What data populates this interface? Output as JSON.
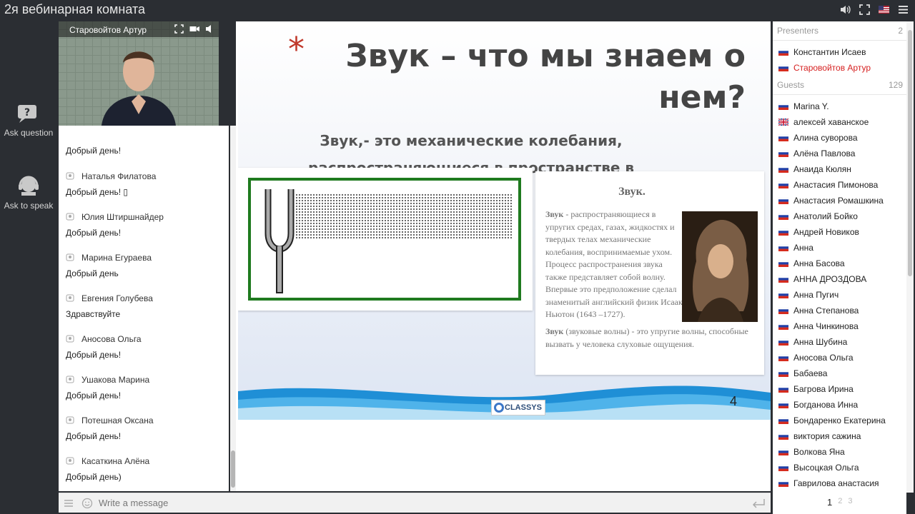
{
  "window": {
    "title": "2я вебинарная комната"
  },
  "rail": {
    "ask_question": "Ask question",
    "ask_to_speak": "Ask to speak"
  },
  "video": {
    "presenter_name": "Старовойтов Артур"
  },
  "chat": {
    "messages": [
      {
        "author": "",
        "text": "Добрый день!"
      },
      {
        "author": "Наталья Филатова",
        "text": "Добрый день! ▯"
      },
      {
        "author": "Юлия Штиршнайдер",
        "text": "Добрый день!"
      },
      {
        "author": "Марина Егураева",
        "text": "Добрый день"
      },
      {
        "author": "Евгения Голубева",
        "text": "Здравствуйте"
      },
      {
        "author": "Аносова Ольга",
        "text": "Добрый день!"
      },
      {
        "author": "Ушакова Марина",
        "text": "Добрый день!"
      },
      {
        "author": "Потешная Оксана",
        "text": "Добрый день!"
      },
      {
        "author": "Касаткина Алёна",
        "text": "Добрый день)"
      }
    ],
    "input_placeholder": "Write a message"
  },
  "slide": {
    "star": "*",
    "heading_line1": "Звук – что мы знаем о",
    "heading_line2": "нем?",
    "sub_line1": "Звук,- это механические колебания,",
    "sub_line2": "распространяющиеся в пространстве в",
    "card_title": "Звук.",
    "card_body_bold": "Звук",
    "card_body": " - распространяющиеся в упругих средах, газах, жидкостях и твердых телах механические колебания, воспринимаемые ухом. Процесс распространения звука также представляет собой волну. Впервые это предположение сделал знаменитый английский физик Исаак Ньютон (1643 –1727).",
    "card_foot_bold": "Звук",
    "card_foot": " (звуковые волны) - это упругие волны, способные вызвать у человека слуховые ощущения.",
    "page_number": "4",
    "logo_text": "CLASSYS"
  },
  "participants": {
    "presenters_label": "Presenters",
    "presenters_count": "2",
    "presenters": [
      {
        "name": "Константин Исаев",
        "flag": "ru",
        "active": false
      },
      {
        "name": "Старовойтов Артур",
        "flag": "ru",
        "active": true
      }
    ],
    "guests_label": "Guests",
    "guests_count": "129",
    "guests": [
      {
        "name": "Marina Y.",
        "flag": "ru"
      },
      {
        "name": "алексей хаванское",
        "flag": "uk"
      },
      {
        "name": "Алина суворова",
        "flag": "ru"
      },
      {
        "name": "Алёна Павлова",
        "flag": "ru"
      },
      {
        "name": "Анаида Кюлян",
        "flag": "ru"
      },
      {
        "name": "Анастасия Пимонова",
        "flag": "ru"
      },
      {
        "name": "Анастасия Ромашкина",
        "flag": "ru"
      },
      {
        "name": "Анатолий Бойко",
        "flag": "ru"
      },
      {
        "name": "Андрей Новиков",
        "flag": "ru"
      },
      {
        "name": "Анна",
        "flag": "ru"
      },
      {
        "name": "Анна Басова",
        "flag": "ru"
      },
      {
        "name": "АННА ДРОЗДОВА",
        "flag": "ru"
      },
      {
        "name": "Анна Пугич",
        "flag": "ru"
      },
      {
        "name": "Анна Степанова",
        "flag": "ru"
      },
      {
        "name": "Анна Чинкинова",
        "flag": "ru"
      },
      {
        "name": "Анна Шубина",
        "flag": "ru"
      },
      {
        "name": "Аносова Ольга",
        "flag": "ru"
      },
      {
        "name": "Бабаева",
        "flag": "ru"
      },
      {
        "name": "Багрова Ирина",
        "flag": "ru"
      },
      {
        "name": "Богданова Инна",
        "flag": "ru"
      },
      {
        "name": "Бондаренко Екатерина",
        "flag": "ru"
      },
      {
        "name": "виктория сажина",
        "flag": "ru"
      },
      {
        "name": "Волкова Яна",
        "flag": "ru"
      },
      {
        "name": "Высоцкая Ольга",
        "flag": "ru"
      },
      {
        "name": "Гаврилова анастасия",
        "flag": "ru"
      }
    ],
    "pages": [
      "1",
      "2",
      "3"
    ]
  },
  "colors": {
    "background": "#2b2e33",
    "active_presenter": "#d62020",
    "slide_frame": "#1f7a1f"
  }
}
